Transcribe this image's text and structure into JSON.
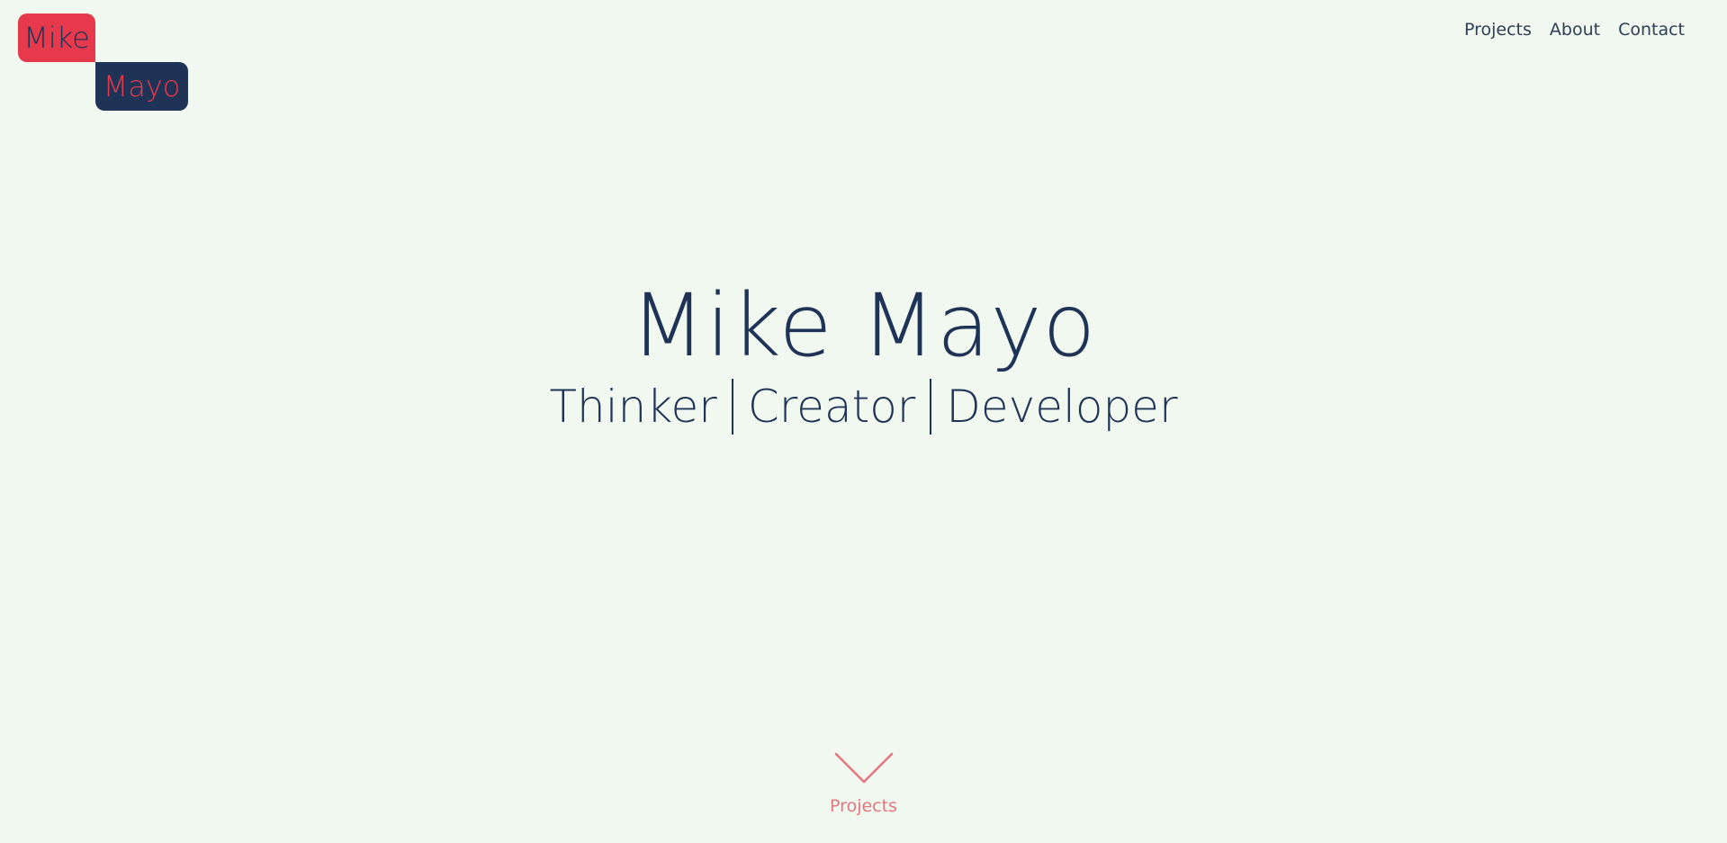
{
  "logo": {
    "first": "Mike",
    "last": "Mayo"
  },
  "nav": {
    "items": [
      "Projects",
      "About",
      "Contact"
    ]
  },
  "hero": {
    "title": "Mike Mayo",
    "roles": [
      "Thinker",
      "Creator",
      "Developer"
    ]
  },
  "scroll_cue": {
    "icon": "chevron-down-icon",
    "label": "Projects"
  },
  "colors": {
    "background": "#f1f8ef",
    "navy": "#1f3356",
    "red": "#e63a4c",
    "soft_red": "#e2777e"
  }
}
